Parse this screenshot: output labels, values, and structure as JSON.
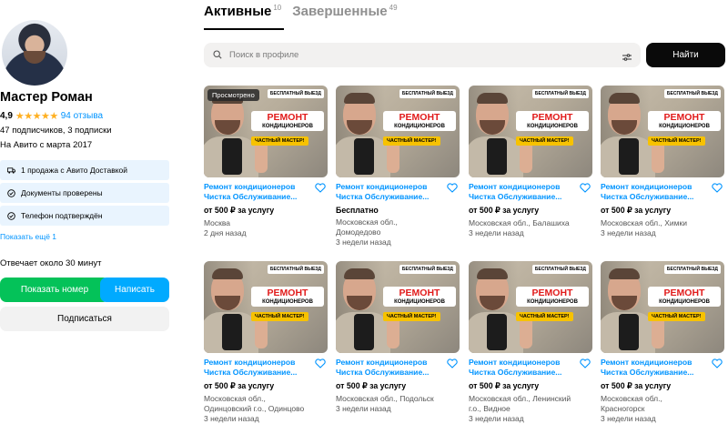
{
  "profile": {
    "name": "Мастер Роман",
    "rating": "4,9",
    "stars": "★★★★★",
    "reviews": "94 отзыва",
    "followers": "47 подписчиков, 3 подписки",
    "since": "На Авито с марта 2017",
    "badges": [
      {
        "icon": "delivery-icon",
        "text": "1 продажа с Авито Доставкой"
      },
      {
        "icon": "check-circle-icon",
        "text": "Документы проверены"
      },
      {
        "icon": "check-circle-icon",
        "text": "Телефон подтверждён"
      }
    ],
    "show_more": "Показать ещё 1",
    "reply_time": "Отвечает около 30 минут",
    "show_phone": "Показать номер",
    "write": "Написать",
    "subscribe": "Подписаться"
  },
  "tabs": [
    {
      "label": "Активные",
      "count": "10"
    },
    {
      "label": "Завершенные",
      "count": "49"
    }
  ],
  "search": {
    "placeholder": "Поиск в профиле",
    "button": "Найти"
  },
  "image_text": {
    "free": "БЕСПЛАТНЫЙ ВЫЕЗД",
    "repair_1": "РЕМОНТ",
    "repair_2": "КОНДИЦИОНЕРОВ",
    "master": "ЧАСТНЫЙ МАСТЕР!",
    "viewed": "Просмотрено"
  },
  "listings": [
    {
      "title_1": "Ремонт кондиционеров",
      "title_2": "Чистка Обслуживание...",
      "price": "от 500 ₽ за услугу",
      "loc_1": "Москва",
      "loc_2": "",
      "date": "2 дня назад",
      "viewed": true
    },
    {
      "title_1": "Ремонт кондиционеров",
      "title_2": "Чистка Обслуживание...",
      "price": "Бесплатно",
      "loc_1": "Московская обл.,",
      "loc_2": "Домодедово",
      "date": "3 недели назад",
      "viewed": false
    },
    {
      "title_1": "Ремонт кондиционеров",
      "title_2": "Чистка Обслуживание...",
      "price": "от 500 ₽ за услугу",
      "loc_1": "Московская обл., Балашиха",
      "loc_2": "",
      "date": "3 недели назад",
      "viewed": false
    },
    {
      "title_1": "Ремонт кондиционеров",
      "title_2": "Чистка Обслуживание...",
      "price": "от 500 ₽ за услугу",
      "loc_1": "Московская обл., Химки",
      "loc_2": "",
      "date": "3 недели назад",
      "viewed": false
    },
    {
      "title_1": "Ремонт кондиционеров",
      "title_2": "Чистка Обслуживание...",
      "price": "от 500 ₽ за услугу",
      "loc_1": "Московская обл.,",
      "loc_2": "Одинцовский г.о., Одинцово",
      "date": "3 недели назад",
      "viewed": false
    },
    {
      "title_1": "Ремонт кондиционеров",
      "title_2": "Чистка Обслуживание...",
      "price": "от 500 ₽ за услугу",
      "loc_1": "Московская обл., Подольск",
      "loc_2": "",
      "date": "3 недели назад",
      "viewed": false
    },
    {
      "title_1": "Ремонт кондиционеров",
      "title_2": "Чистка Обслуживание...",
      "price": "от 500 ₽ за услугу",
      "loc_1": "Московская обл., Ленинский",
      "loc_2": "г.о., Видное",
      "date": "3 недели назад",
      "viewed": false
    },
    {
      "title_1": "Ремонт кондиционеров",
      "title_2": "Чистка Обслуживание...",
      "price": "от 500 ₽ за услугу",
      "loc_1": "Московская обл.,",
      "loc_2": "Красногорск",
      "date": "3 недели назад",
      "viewed": false
    }
  ],
  "colors": {
    "accent": "#0094ff",
    "green": "#04c259",
    "blue_button": "#00aaff",
    "star": "#ffb021",
    "repair_red": "#e11b1b",
    "master_yellow": "#f7c200"
  }
}
